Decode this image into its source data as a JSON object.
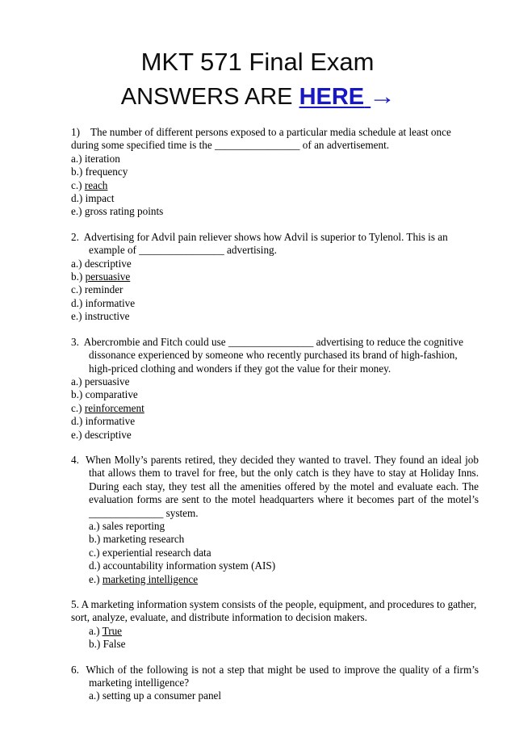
{
  "document": {
    "title_line_1": "MKT 571 Final Exam",
    "title_line_2_prefix": "ANSWERS ARE ",
    "title_link_text": "HERE",
    "title_arrow": "→",
    "link_color": "#1717c4"
  },
  "questions": [
    {
      "number": "1)",
      "number_gap": "    ",
      "text_line_1": "The number of different persons exposed to a particular media schedule at least once during",
      "text_line_2": "some specified time is the ________________ of an advertisement.",
      "full_text": "1)    The number of different persons exposed to a particular media schedule at least once during some specified time is the ________________ of an advertisement.",
      "layout": "flow",
      "options_indent": false,
      "options": [
        {
          "label": "a.)",
          "text": "iteration",
          "answer": false
        },
        {
          "label": "b.)",
          "text": "frequency",
          "answer": false
        },
        {
          "label": "c.)",
          "text": "reach",
          "answer": true
        },
        {
          "label": "d.)",
          "text": "impact",
          "answer": false
        },
        {
          "label": "e.)",
          "text": "gross rating points",
          "answer": false
        }
      ]
    },
    {
      "number": "2.",
      "number_gap": "  ",
      "full_text": "Advertising for Advil pain reliever shows how Advil is superior to Tylenol.  This is an example of  ________________ advertising.",
      "layout": "hanging",
      "options_indent": false,
      "options": [
        {
          "label": "a.)",
          "text": "descriptive",
          "answer": false
        },
        {
          "label": "b.)",
          "text": "persuasive",
          "answer": true
        },
        {
          "label": "c.)",
          "text": "reminder",
          "answer": false
        },
        {
          "label": "d.)",
          "text": "informative",
          "answer": false
        },
        {
          "label": "e.)",
          "text": "instructive",
          "answer": false
        }
      ]
    },
    {
      "number": "3.",
      "number_gap": "  ",
      "full_text": "Abercrombie and Fitch could use ________________ advertising to reduce the cognitive dissonance experienced by someone who recently purchased its brand of high-fashion, high-priced clothing and wonders if they got the value for their money.",
      "layout": "hanging",
      "options_indent": false,
      "options": [
        {
          "label": "a.)",
          "text": "persuasive",
          "answer": false
        },
        {
          "label": "b.)",
          "text": "comparative",
          "answer": false
        },
        {
          "label": "c.)",
          "text": "reinforcement",
          "answer": true
        },
        {
          "label": "d.)",
          "text": "informative",
          "answer": false
        },
        {
          "label": "e.)",
          "text": "descriptive",
          "answer": false
        }
      ]
    },
    {
      "number": "4.",
      "number_gap": "  ",
      "full_text": "When Molly’s parents retired, they decided they wanted to travel.  They found an ideal job that allows them to travel for free, but the only catch is they have to stay at Holiday Inns.  During each stay, they test all the amenities offered by the motel and evaluate each.  The evaluation forms are sent to the motel headquarters where it becomes part of the motel’s ______________ system.",
      "layout": "hanging-justified",
      "options_indent": true,
      "options": [
        {
          "label": "a.)",
          "text": "sales reporting",
          "answer": false
        },
        {
          "label": "b.)",
          "text": "marketing research",
          "answer": false
        },
        {
          "label": "c.)",
          "text": "experiential research data",
          "answer": false
        },
        {
          "label": "d.)",
          "text": "accountability information system (AIS)",
          "answer": false
        },
        {
          "label": "e.)",
          "text": "marketing intelligence",
          "answer": true
        }
      ]
    },
    {
      "number": "5.",
      "number_gap": " ",
      "full_text": "A marketing information system consists of the people, equipment, and procedures to gather, sort, analyze, evaluate, and distribute information to decision makers.",
      "layout": "flow",
      "options_indent": true,
      "options": [
        {
          "label": "a.)",
          "text": "True",
          "answer": true
        },
        {
          "label": "b.)",
          "text": "False",
          "answer": false
        }
      ]
    },
    {
      "number": "6.",
      "number_gap": "  ",
      "full_text": "Which of the following is not a step that might be used to improve the quality of a firm’s marketing intelligence?",
      "layout": "hanging-justified",
      "options_indent": true,
      "options": [
        {
          "label": "a.)",
          "text": "setting up a consumer panel",
          "answer": false
        }
      ]
    }
  ]
}
